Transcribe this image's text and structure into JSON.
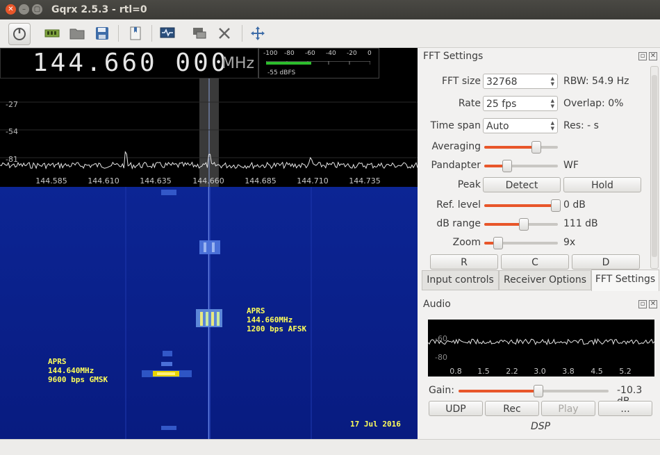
{
  "window": {
    "title": "Gqrx 2.5.3 - rtl=0"
  },
  "frequency": {
    "value": "144.660 000",
    "unit": "MHz"
  },
  "smeter": {
    "ticks": [
      "-100",
      "-80",
      "-60",
      "-40",
      "-20",
      "0"
    ],
    "reading": "-55 dBFS",
    "level_fraction": 0.43
  },
  "pandapter": {
    "y_labels": [
      "-27",
      "-54",
      "-81"
    ],
    "x_labels": [
      "144.585",
      "144.610",
      "144.635",
      "144.660",
      "144.685",
      "144.710",
      "144.735"
    ]
  },
  "waterfall": {
    "label_a": "APRS\n144.660MHz\n1200 bps AFSK",
    "label_b": "APRS\n144.640MHz\n9600 bps GMSK",
    "date": "17 Jul 2016"
  },
  "fft_settings": {
    "title": "FFT Settings",
    "fft_size": {
      "label": "FFT size",
      "value": "32768",
      "info": "RBW: 54.9 Hz"
    },
    "rate": {
      "label": "Rate",
      "value": "25 fps",
      "info": "Overlap: 0%"
    },
    "time_span": {
      "label": "Time span",
      "value": "Auto",
      "info": "Res: - s"
    },
    "averaging": {
      "label": "Averaging",
      "level": 0.7
    },
    "pandapter": {
      "label": "Pandapter",
      "level": 0.3,
      "info": "WF"
    },
    "peak": {
      "label": "Peak",
      "detect": "Detect",
      "hold": "Hold"
    },
    "ref_level": {
      "label": "Ref. level",
      "level": 0.96,
      "info": "0 dB"
    },
    "db_range": {
      "label": "dB range",
      "level": 0.53,
      "info": "111 dB"
    },
    "zoom": {
      "label": "Zoom",
      "level": 0.18,
      "info": "9x"
    },
    "buttons": [
      "R",
      "C",
      "D"
    ]
  },
  "tabs": [
    "Input controls",
    "Receiver Options",
    "FFT Settings"
  ],
  "audio": {
    "title": "Audio",
    "y_labels": [
      "-60",
      "-80"
    ],
    "x_labels": [
      "0.8",
      "1.5",
      "2.2",
      "3.0",
      "3.8",
      "4.5",
      "5.2"
    ],
    "gain_label": "Gain:",
    "gain_value": "-10.3 dB",
    "gain_level": 0.53,
    "buttons": [
      "UDP",
      "Rec",
      "Play",
      "..."
    ],
    "dsp": "DSP"
  }
}
